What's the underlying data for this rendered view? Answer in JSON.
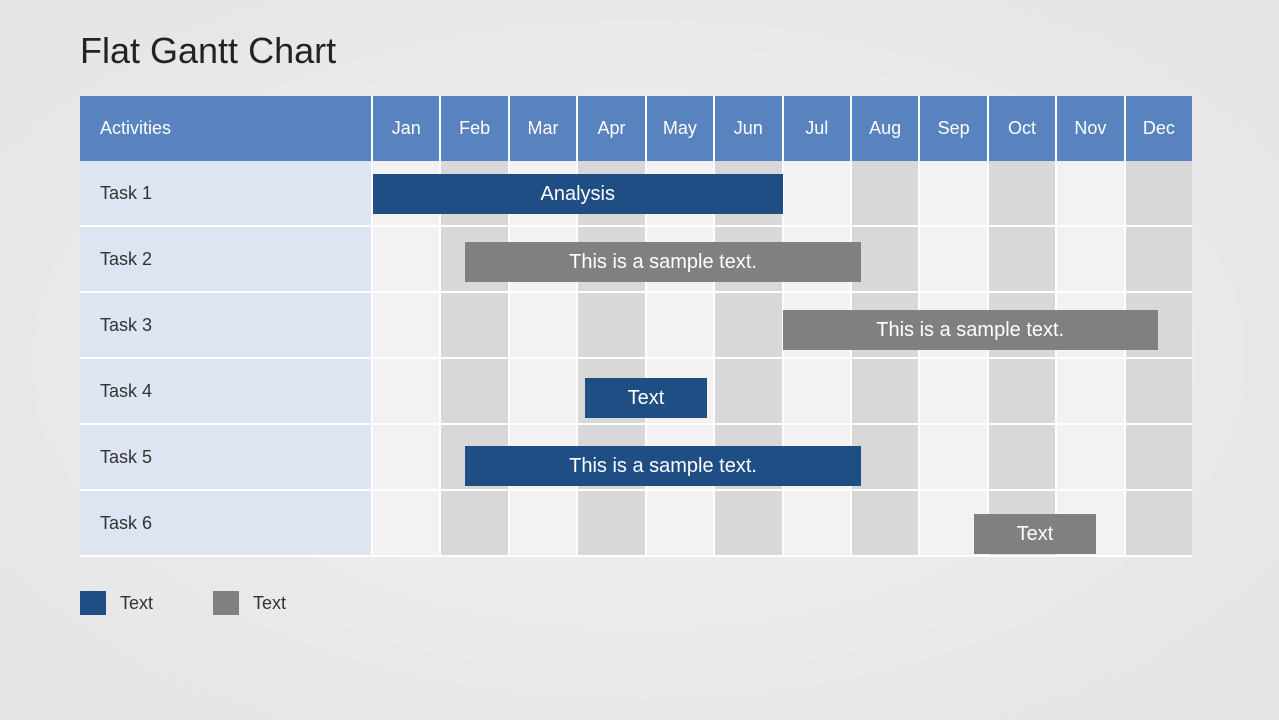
{
  "title": "Flat Gantt Chart",
  "activities_header": "Activities",
  "months": [
    "Jan",
    "Feb",
    "Mar",
    "Apr",
    "May",
    "Jun",
    "Jul",
    "Aug",
    "Sep",
    "Oct",
    "Nov",
    "Dec"
  ],
  "tasks": [
    "Task 1",
    "Task 2",
    "Task 3",
    "Task 4",
    "Task 5",
    "Task 6"
  ],
  "bars": [
    {
      "row": 0,
      "label": "Analysis",
      "start": 0.0,
      "span": 6.0,
      "color": "blue"
    },
    {
      "row": 1,
      "label": "This is a sample text.",
      "start": 1.35,
      "span": 5.8,
      "color": "gray"
    },
    {
      "row": 2,
      "label": "This is a sample text.",
      "start": 6.0,
      "span": 5.5,
      "color": "gray"
    },
    {
      "row": 3,
      "label": "Text",
      "start": 3.1,
      "span": 1.8,
      "color": "blue"
    },
    {
      "row": 4,
      "label": "This is a sample text.",
      "start": 1.35,
      "span": 5.8,
      "color": "blue"
    },
    {
      "row": 5,
      "label": "Text",
      "start": 8.8,
      "span": 1.8,
      "color": "gray"
    }
  ],
  "legend": [
    {
      "color": "blue",
      "label": "Text"
    },
    {
      "color": "gray",
      "label": "Text"
    }
  ],
  "chart_data": {
    "type": "bar",
    "title": "Flat Gantt Chart",
    "xlabel": "",
    "ylabel": "Activities",
    "categories": [
      "Jan",
      "Feb",
      "Mar",
      "Apr",
      "May",
      "Jun",
      "Jul",
      "Aug",
      "Sep",
      "Oct",
      "Nov",
      "Dec"
    ],
    "series": [
      {
        "name": "Task 1",
        "start_month": "Jan",
        "end_month": "Jun",
        "label": "Analysis",
        "color": "blue"
      },
      {
        "name": "Task 2",
        "start_month": "Feb",
        "end_month": "Jul",
        "label": "This is a sample text.",
        "color": "gray"
      },
      {
        "name": "Task 3",
        "start_month": "Jul",
        "end_month": "Nov",
        "label": "This is a sample text.",
        "color": "gray"
      },
      {
        "name": "Task 4",
        "start_month": "Apr",
        "end_month": "May",
        "label": "Text",
        "color": "blue"
      },
      {
        "name": "Task 5",
        "start_month": "Feb",
        "end_month": "Jul",
        "label": "This is a sample text.",
        "color": "blue"
      },
      {
        "name": "Task 6",
        "start_month": "Oct",
        "end_month": "Nov",
        "label": "Text",
        "color": "gray"
      }
    ],
    "legend": [
      "Text",
      "Text"
    ]
  }
}
